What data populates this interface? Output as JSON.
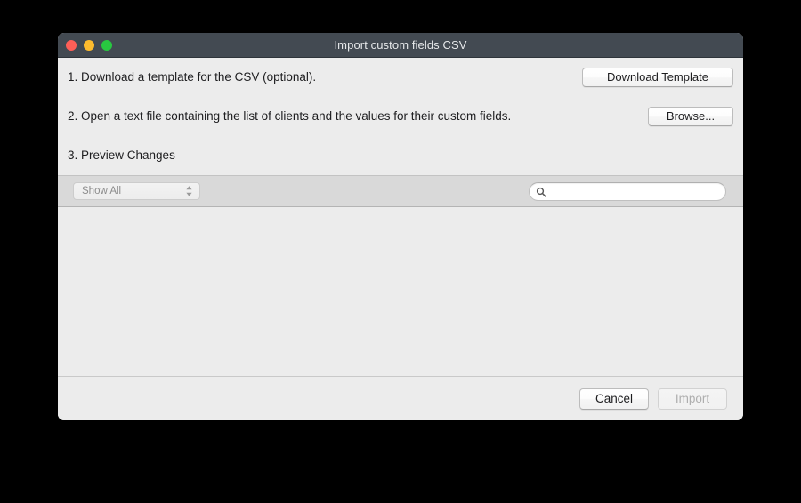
{
  "window": {
    "title": "Import custom fields CSV",
    "traffic_lights": [
      {
        "name": "close",
        "icon": "close-button-icon",
        "color": "#ff5f57"
      },
      {
        "name": "minimize",
        "icon": "minimize-button-icon",
        "color": "#febc2e"
      },
      {
        "name": "zoom",
        "icon": "zoom-button-icon",
        "color": "#28c840"
      }
    ],
    "titlebar_color": "#434a52",
    "body_color": "#ececec",
    "toolbar_color": "#d9d9d9"
  },
  "steps": [
    {
      "text": "1. Download a template for the CSV (optional).",
      "action_label": "Download Template"
    },
    {
      "text": "2. Open a text file containing the list of clients and the values for their custom fields.",
      "action_label": "Browse..."
    },
    {
      "text": "3. Preview Changes"
    }
  ],
  "filter_bar": {
    "show_filter": {
      "selected": "Show All",
      "options": [
        "Show All"
      ],
      "enabled": false,
      "icon": "chevron-up-down-icon"
    },
    "search": {
      "value": "",
      "placeholder": "",
      "icon": "search-icon"
    }
  },
  "preview_list": {
    "rows": [],
    "empty": true
  },
  "footer": {
    "cancel_label": "Cancel",
    "import_label": "Import",
    "import_enabled": false
  }
}
